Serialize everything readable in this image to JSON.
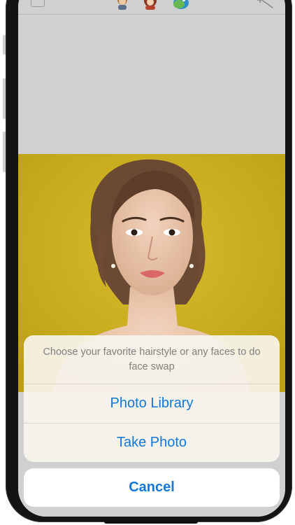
{
  "toolbar": {
    "left_icon": "square-icon",
    "characters": [
      "character-boy-icon",
      "character-girl-icon",
      "character-bird-icon"
    ],
    "right_icon": "magic-wand-icon"
  },
  "photo": {
    "subject": "portrait",
    "background_color": "#c9ae1e"
  },
  "action_sheet": {
    "message": "Choose your favorite hairstyle or any faces to do face swap",
    "actions": [
      {
        "label": "Photo Library"
      },
      {
        "label": "Take Photo"
      }
    ],
    "cancel_label": "Cancel"
  },
  "colors": {
    "accent": "#1477d6",
    "message_text": "#808080"
  }
}
